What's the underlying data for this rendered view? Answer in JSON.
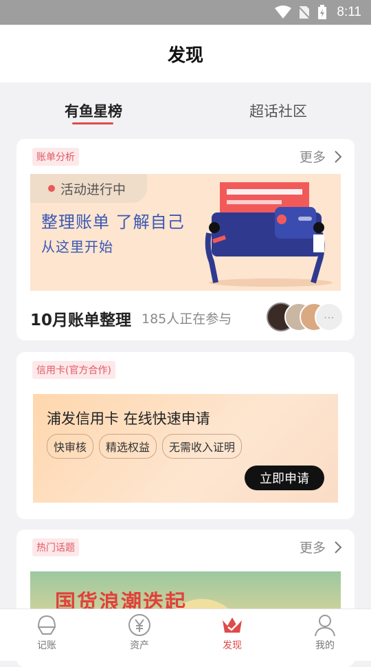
{
  "status_bar": {
    "time": "8:11"
  },
  "header": {
    "title": "发现"
  },
  "tabs": [
    {
      "label": "有鱼星榜",
      "active": true
    },
    {
      "label": "超话社区",
      "active": false
    }
  ],
  "bill_card": {
    "tag": "账单分析",
    "more": "更多",
    "activity_badge": "活动进行中",
    "banner_line1": "整理账单 了解自己",
    "banner_line2": "从这里开始",
    "title": "10月账单整理",
    "participants": "185人正在参与"
  },
  "credit_card": {
    "tag": "信用卡(官方合作)",
    "title": "浦发信用卡 在线快速申请",
    "chips": [
      "快审核",
      "精选权益",
      "无需收入证明"
    ],
    "apply_button": "立即申请"
  },
  "topic_card": {
    "tag": "热门话题",
    "more": "更多",
    "banner_text": "国货浪潮迭起"
  },
  "bottom_nav": [
    {
      "label": "记账",
      "icon": "bookkeeping-icon",
      "active": false
    },
    {
      "label": "资产",
      "icon": "yuan-icon",
      "active": false
    },
    {
      "label": "发现",
      "icon": "crown-icon",
      "active": true
    },
    {
      "label": "我的",
      "icon": "person-icon",
      "active": false
    }
  ],
  "colors": {
    "accent": "#e04a4a",
    "tag_bg": "#fde8ea",
    "tag_text": "#e05a64",
    "banner_blue": "#3b57b5"
  }
}
